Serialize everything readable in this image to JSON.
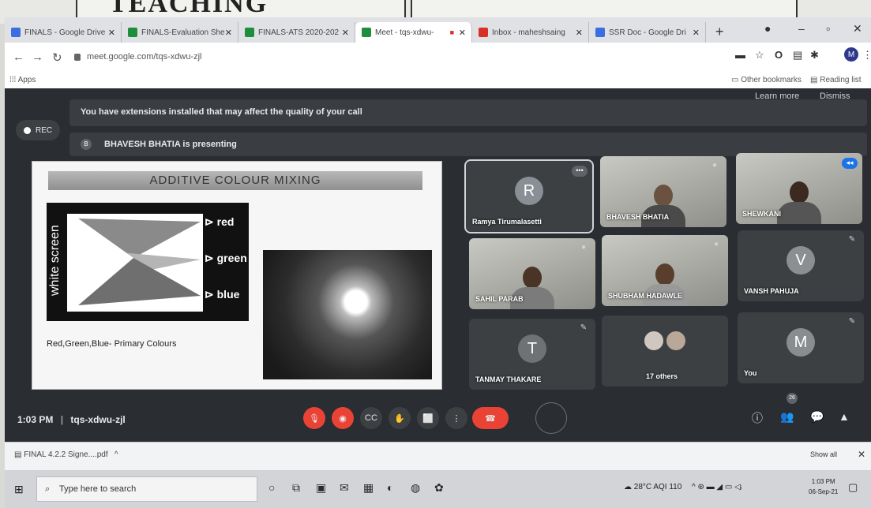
{
  "browser": {
    "tabs": [
      {
        "label": "FINALS - Google Drive",
        "color": "#3b6ee0"
      },
      {
        "label": "FINALS-Evaluation She",
        "color": "#1e8e3e"
      },
      {
        "label": "FINALS-ATS 2020-202",
        "color": "#1e8e3e"
      },
      {
        "label": "Meet - tqs-xdwu-",
        "color": "#1e8e3e"
      },
      {
        "label": "Inbox - maheshsaing",
        "color": "#d93025"
      },
      {
        "label": "SSR Doc - Google Dri",
        "color": "#3b6ee0"
      }
    ],
    "url": "meet.google.com/tqs-xdwu-zjl",
    "avatar_initial": "M",
    "bookmarks": {
      "apps": "Apps",
      "other": "Other bookmarks",
      "reading": "Reading list"
    }
  },
  "meet": {
    "banner_text": "You have extensions installed that may affect the quality of your call",
    "learn_more": "Learn more",
    "dismiss": "Dismiss",
    "rec_label": "REC",
    "presenter_initial": "B",
    "presenting_text": "BHAVESH BHATIA is presenting",
    "slide": {
      "title": "ADDITIVE COLOUR MIXING",
      "screen_label": "white screen",
      "rays": [
        "red",
        "green",
        "blue"
      ],
      "caption": "Red,Green,Blue- Primary Colours"
    },
    "tiles": [
      {
        "name": "Ramya Tirumalasetti",
        "initial": "R",
        "type": "avatar"
      },
      {
        "name": "BHAVESH BHATIA",
        "initial": "",
        "type": "video"
      },
      {
        "name": "SHEWKANI",
        "initial": "",
        "type": "video"
      },
      {
        "name": "SAHIL PARAB",
        "initial": "",
        "type": "video"
      },
      {
        "name": "SHUBHAM HADAWLE",
        "initial": "",
        "type": "video"
      },
      {
        "name": "VANSH PAHUJA",
        "initial": "V",
        "type": "avatar"
      },
      {
        "name": "TANMAY THAKARE",
        "initial": "T",
        "type": "avatar"
      },
      {
        "name": "17 others",
        "initial": "",
        "type": "group"
      },
      {
        "name": "You",
        "initial": "M",
        "type": "avatar"
      }
    ],
    "time": "1:03 PM",
    "meeting_code": "tqs-xdwu-zjl",
    "participant_count": "26"
  },
  "downloads": {
    "file": "FINAL 4.2.2 Signe....pdf",
    "show_all": "Show all"
  },
  "taskbar": {
    "search_placeholder": "Type here to search",
    "weather": "28°C AQI 110",
    "time": "1:03 PM",
    "date": "06-Sep-21"
  }
}
